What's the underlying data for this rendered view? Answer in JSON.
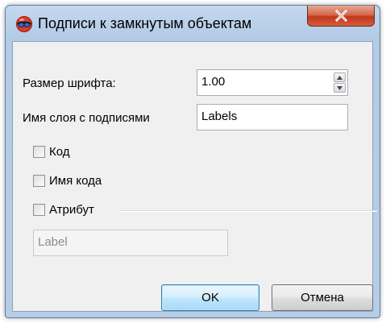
{
  "dialog": {
    "title": "Подписи к замкнутым объектам"
  },
  "fields": {
    "font_size_label": "Размер шрифта:",
    "font_size_value": "1.00",
    "layer_name_label": "Имя слоя с подписями",
    "layer_name_value": "Labels"
  },
  "checkboxes": {
    "code_label": "Код",
    "code_checked": false,
    "code_name_label": "Имя кода",
    "code_name_checked": false,
    "attribute_label": "Атрибут",
    "attribute_checked": false
  },
  "attribute_group": {
    "field_value": "Label"
  },
  "buttons": {
    "ok_label": "OK",
    "cancel_label": "Отмена"
  },
  "icons": {
    "app": "ball-with-glasses-icon",
    "close": "close-icon",
    "spin_up": "spin-up-icon",
    "spin_down": "spin-down-icon"
  },
  "colors": {
    "close_button": "#c7432a",
    "default_button_border": "#3c7fb1",
    "title_bar": "#b9d0e8"
  }
}
